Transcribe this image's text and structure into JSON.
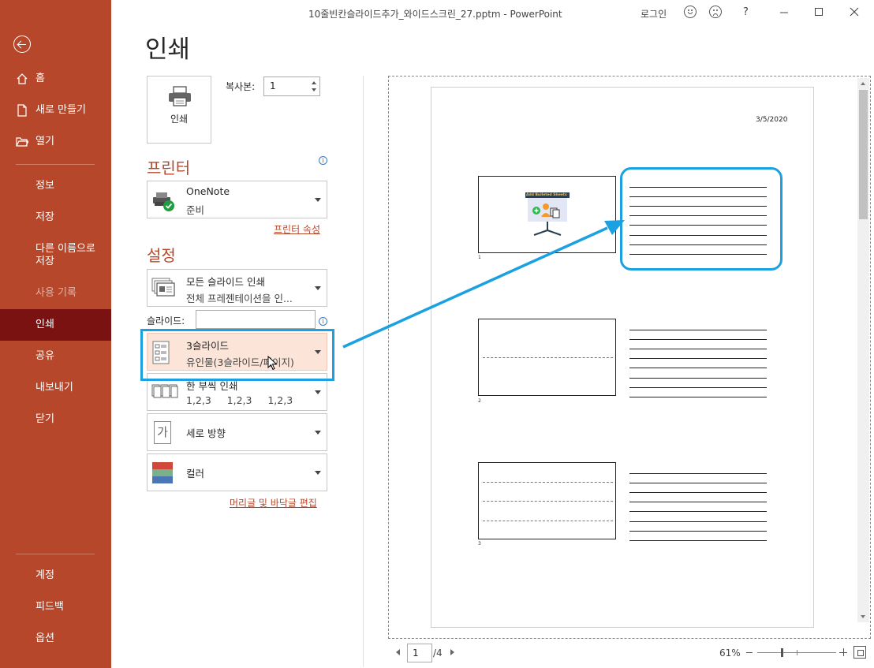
{
  "window": {
    "title": "10줄빈칸슬라이드추가_와이드스크린_27.pptm  -  PowerPoint",
    "login": "로그인",
    "help": "?"
  },
  "sidebar": {
    "items": [
      {
        "label": "홈"
      },
      {
        "label": "새로 만들기"
      },
      {
        "label": "열기"
      },
      {
        "label": "정보"
      },
      {
        "label": "저장"
      },
      {
        "label": "다른 이름으로\n저장"
      },
      {
        "label": "사용 기록"
      },
      {
        "label": "인쇄"
      },
      {
        "label": "공유"
      },
      {
        "label": "내보내기"
      },
      {
        "label": "닫기"
      },
      {
        "label": "계정"
      },
      {
        "label": "피드백"
      },
      {
        "label": "옵션"
      }
    ],
    "active": "인쇄"
  },
  "print": {
    "title": "인쇄",
    "button_label": "인쇄",
    "copies_label": "복사본:",
    "copies_value": "1",
    "printer_heading": "프린터",
    "printer_name": "OneNote",
    "printer_status": "준비",
    "printer_properties": "프린터 속성",
    "settings_heading": "설정",
    "range": {
      "line1": "모든 슬라이드 인쇄",
      "line2": "전체 프레젠테이션을 인..."
    },
    "slides_label": "슬라이드:",
    "slides_value": "",
    "layout": {
      "line1": "3슬라이드",
      "line2": "유인물(3슬라이드/페이지)"
    },
    "collate": {
      "line1": "한 부씩 인쇄",
      "line2": "1,2,3     1,2,3     1,2,3"
    },
    "orientation": {
      "label": "세로 방향",
      "glyph": "가"
    },
    "color": {
      "label": "컬러"
    },
    "header_footer_link": "머리글 및 바닥글 편집"
  },
  "preview": {
    "date": "3/5/2020",
    "slides": [
      {
        "num": "1"
      },
      {
        "num": "2"
      },
      {
        "num": "3"
      }
    ],
    "thumbnail_banner": "Add Bulleted Sheets"
  },
  "page_nav": {
    "current": "1",
    "total": "/4"
  },
  "zoom": {
    "label": "61%",
    "level": 0.61
  },
  "colors": {
    "sidebar": "#b7472a",
    "sidebar_active": "#7b1212",
    "accent": "#b7472a",
    "highlight": "#1ba1e2",
    "selected_bg": "#fce4d9"
  }
}
